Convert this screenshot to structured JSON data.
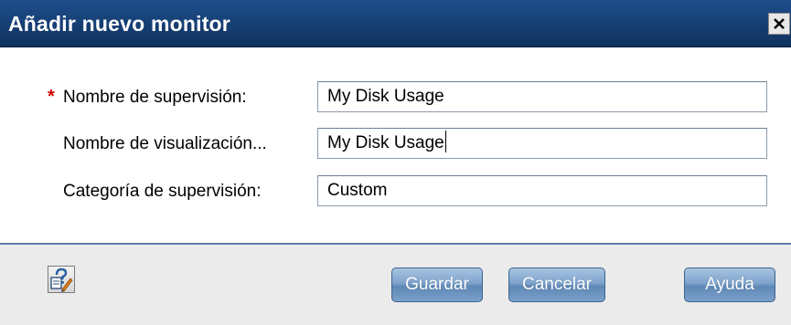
{
  "dialog": {
    "title": "Añadir nuevo monitor",
    "close_label": "Close"
  },
  "form": {
    "fields": [
      {
        "label": "Nombre de supervisión:",
        "value": "My Disk Usage",
        "required": true,
        "required_marker": "*"
      },
      {
        "label": "Nombre de visualización...",
        "value": "My Disk Usage",
        "required": false,
        "focused": true
      },
      {
        "label": "Categoría de supervisión:",
        "value": "Custom",
        "required": false
      }
    ]
  },
  "footer": {
    "help_icon": "context-help-icon",
    "save_label": "Guardar",
    "cancel_label": "Cancelar",
    "help_label": "Ayuda"
  },
  "colors": {
    "titlebar": "#163e73",
    "required_marker": "#d40000",
    "button": "#6f96c1",
    "footer": "#ebebeb"
  }
}
